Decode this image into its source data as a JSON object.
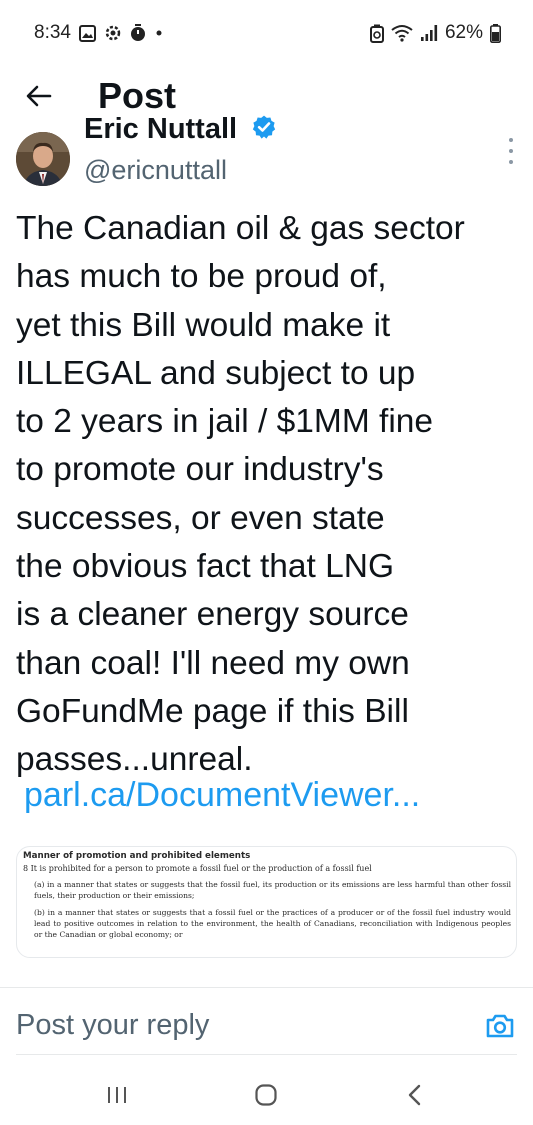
{
  "status_bar": {
    "time": "8:34",
    "battery": "62%",
    "left_icons": [
      "gallery-icon",
      "settings-icon",
      "timer-icon",
      "dot-icon"
    ],
    "right_icons": [
      "battery-saver-icon",
      "wifi-icon",
      "signal-icon",
      "battery-icon"
    ],
    "battery_level": 0.62
  },
  "header": {
    "title": "Post"
  },
  "author": {
    "name": "Eric Nuttall",
    "handle": "@ericnuttall",
    "verified_color": "#1d9bf0"
  },
  "post": {
    "lines": [
      "The Canadian oil & gas sector",
      "has much to be proud of,",
      "yet this Bill would make it",
      "ILLEGAL and subject to up",
      "to 2 years in jail / $1MM fine",
      "to promote our industry's",
      "successes, or even state",
      "the obvious fact that LNG",
      "is a cleaner energy source",
      "than coal! I'll need my own",
      "GoFundMe page if this Bill",
      "passes...unreal."
    ],
    "link": "parl.ca/DocumentViewer...",
    "link_color": "#1d9bf0"
  },
  "document": {
    "heading": "Manner of promotion and prohibited elements",
    "section": "8 It is prohibited for a person to promote a fossil fuel or the production of a fossil fuel",
    "para_a": "(a) in a manner that states or suggests that the fossil fuel, its production or its emissions are less harmful than other fossil fuels, their production or their emissions;",
    "para_b": "(b) in a manner that states or suggests that a fossil fuel or the practices of a producer or of the fossil fuel industry would lead to positive outcomes in relation to the environment, the health of Canadians, reconciliation with Indigenous peoples or the Canadian or global economy; or"
  },
  "reply": {
    "placeholder": "Post your reply",
    "accent": "#1d9bf0"
  },
  "navigation": {
    "buttons": [
      "recent-apps-icon",
      "home-icon",
      "back-icon"
    ]
  }
}
